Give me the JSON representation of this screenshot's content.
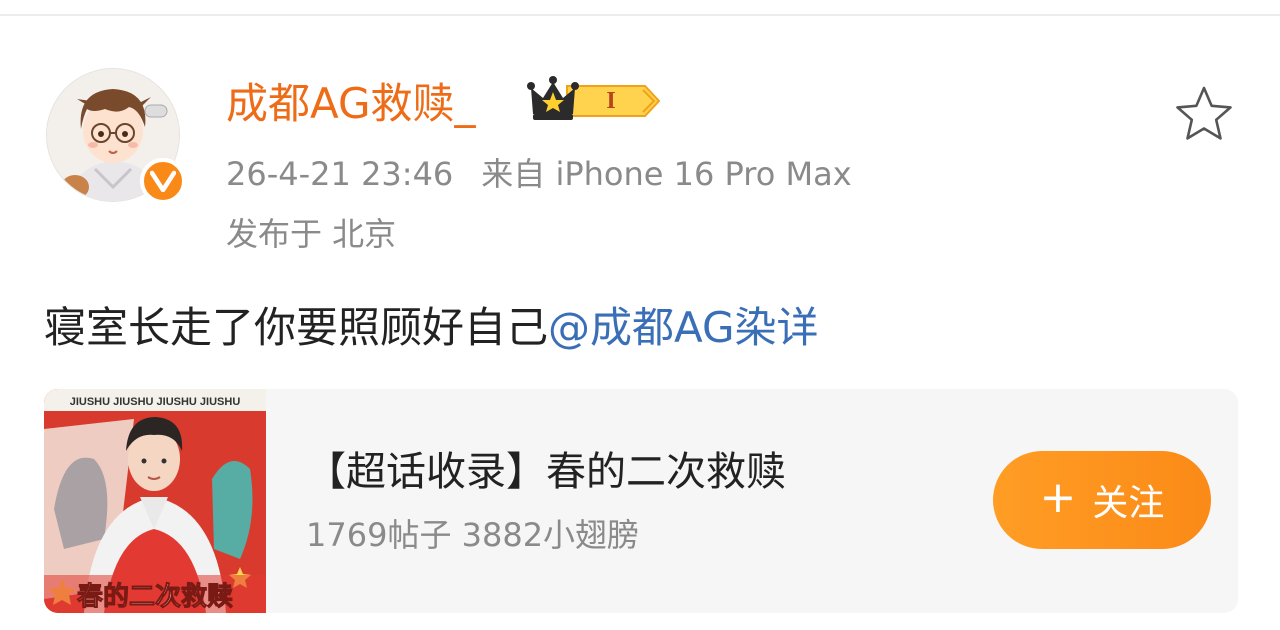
{
  "post": {
    "author": {
      "name": "成都AG救赎_",
      "vip_level": "I",
      "verified_label": "V"
    },
    "timestamp": "26-4-21 23:46",
    "source": "来自 iPhone 16 Pro Max",
    "location": "发布于 北京",
    "text": "寝室长走了你要照顾好自己",
    "mention": "@成都AG染详"
  },
  "topic": {
    "title": "【超话收录】春的二次救赎",
    "stats": "1769帖子 3882小翅膀",
    "follow_plus": "+",
    "follow_label": "关注",
    "cover_banner": "JIUSHU JIUSHU JIUSHU JIUSHU",
    "cover_caption": "春的二次救赎"
  },
  "colors": {
    "username": "#ee6b17",
    "mention": "#3a6fb7",
    "follow_button": "#fb8a17",
    "meta_text": "#8a8a8a"
  },
  "icons": {
    "favorite": "star-outline-icon",
    "verified": "verified-v-icon",
    "vip": "crown-icon"
  }
}
